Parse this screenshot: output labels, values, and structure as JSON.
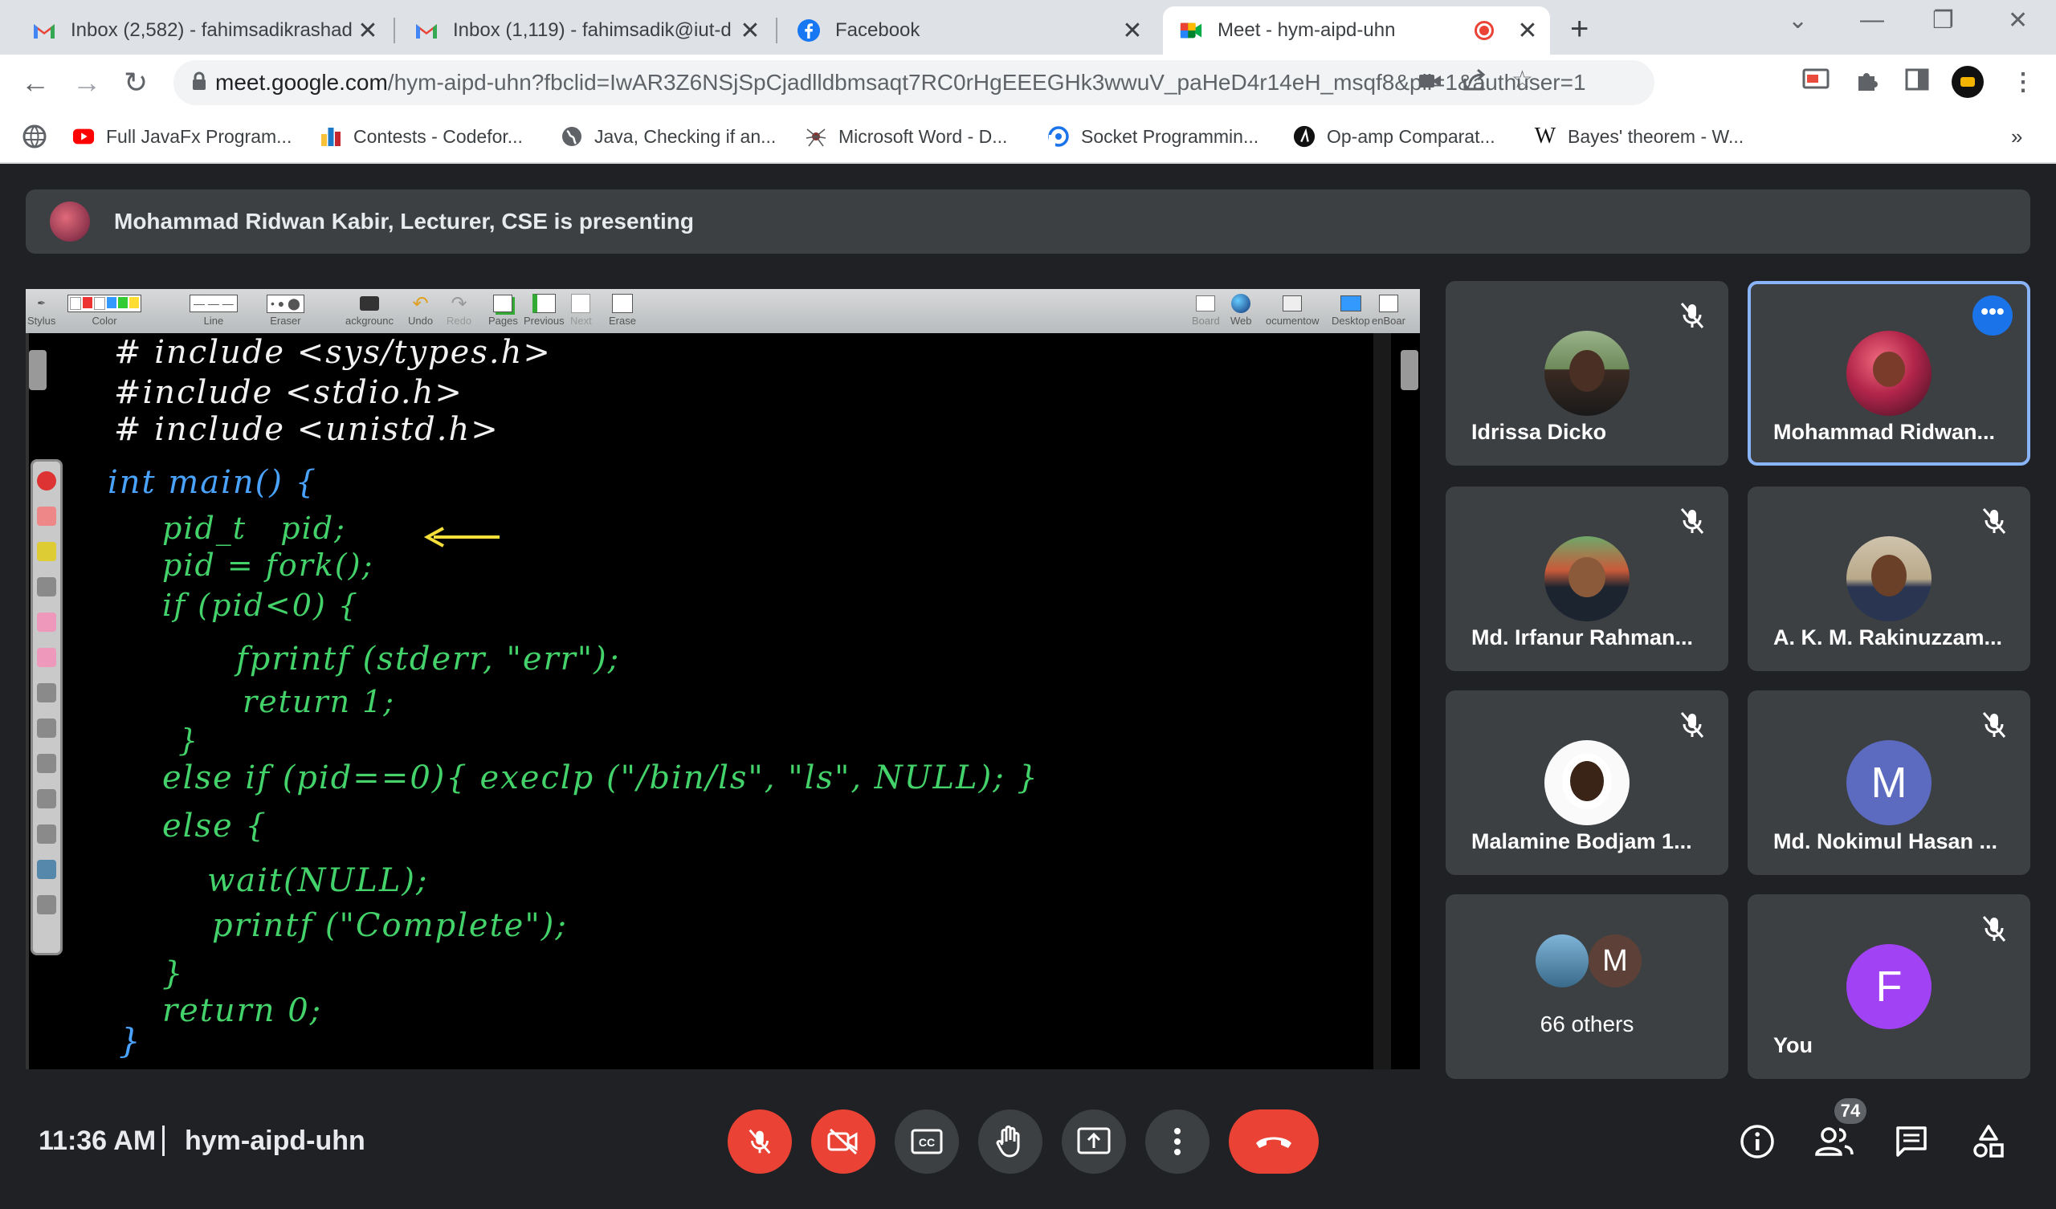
{
  "browser": {
    "tabs": [
      {
        "title": "Inbox (2,582) - fahimsadikrashad",
        "icon": "gmail-icon"
      },
      {
        "title": "Inbox (1,119) - fahimsadik@iut-d",
        "icon": "gmail-icon"
      },
      {
        "title": "Facebook",
        "icon": "facebook-icon"
      },
      {
        "title": "Meet - hym-aipd-uhn",
        "icon": "meet-icon",
        "active": true
      }
    ],
    "url_host": "meet.google.com",
    "url_path": "/hym-aipd-uhn?fbclid=IwAR3Z6NSjSpCjadlldbmsaqt7RC0rHgEEEGHk3wwuV_paHeD4r14eH_msqf8&pli=1&authuser=1",
    "bookmarks": [
      {
        "label": "Full JavaFx Program...",
        "icon": "youtube-icon"
      },
      {
        "label": "Contests - Codefor...",
        "icon": "codeforces-icon"
      },
      {
        "label": "Java, Checking if an...",
        "icon": "globe-icon"
      },
      {
        "label": "Microsoft Word - D...",
        "icon": "spider-icon"
      },
      {
        "label": "Socket Programmin...",
        "icon": "socket-icon"
      },
      {
        "label": "Op-amp Comparat...",
        "icon": "opamp-icon"
      },
      {
        "label": "Bayes' theorem - W...",
        "icon": "wikipedia-icon"
      }
    ],
    "more_bookmarks": "»"
  },
  "meet": {
    "presenting_text": "Mohammad Ridwan Kabir, Lecturer, CSE is presenting",
    "whiteboard": {
      "toolbar": [
        "Stylus",
        "Color",
        "Line",
        "Eraser",
        "ackgrounc",
        "Undo",
        "Redo",
        "Pages",
        "Previous",
        "Next",
        "Erase"
      ],
      "toolbar_right": [
        "Board",
        "Web",
        "ocumentow",
        "Desktop",
        "enBoar"
      ],
      "code_lines": [
        "# include <sys/types.h>",
        "#include <stdio.h>",
        "# include <unistd.h>",
        "int main() {",
        "pid_t   pid;",
        "pid = fork();",
        "if (pid<0) {",
        "fprintf (stderr, \"err\");",
        "return 1;",
        "}",
        "else if (pid==0){ execlp (\"/bin/ls\", \"ls\", NULL); }",
        "else {",
        "wait(NULL);",
        "printf (\"Complete\");",
        "}",
        "return 0;",
        "}"
      ]
    },
    "participants": [
      {
        "name": "Idrissa Dicko",
        "muted": true
      },
      {
        "name": "Mohammad Ridwan...",
        "speaking": true
      },
      {
        "name": "Md. Irfanur Rahman...",
        "muted": true
      },
      {
        "name": "A. K. M. Rakinuzzam...",
        "muted": true
      },
      {
        "name": "Malamine Bodjam 1...",
        "muted": true
      },
      {
        "name": "Md. Nokimul Hasan ...",
        "muted": true,
        "initial": "M",
        "color": "#5c6bc0"
      },
      {
        "name": "66 others",
        "initial": "M"
      },
      {
        "name": "You",
        "muted": true,
        "initial": "F",
        "color": "#a142f4"
      }
    ],
    "more_options_label": "•••",
    "time": "11:36 AM",
    "meeting_code": "hym-aipd-uhn",
    "participant_count": "74"
  }
}
